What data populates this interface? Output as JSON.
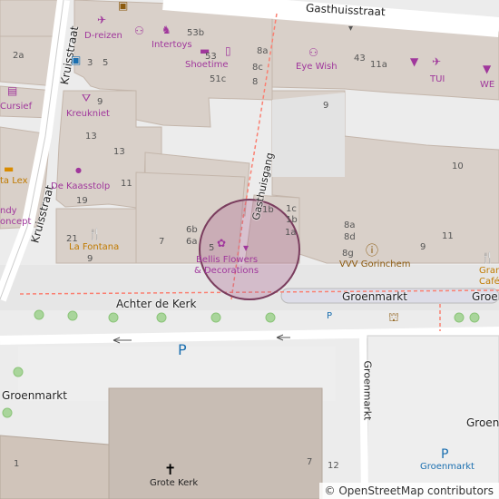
{
  "attribution": "© OpenStreetMap contributors",
  "colors": {
    "building": "#d9d0c9",
    "building_stroke": "#c4b6ab",
    "footway": "#fa8072",
    "poi": "#a0379c",
    "marker": "#a85c8c"
  },
  "streets": {
    "gasthuisstraat": "Gasthuisstraat",
    "kruisstraat_top": "Kruisstraat",
    "kruisstraat_bottom": "Kruisstraat",
    "gasthuisgang": "Gasthuisgang",
    "groenmarkt": "Groenmarkt",
    "groenmarkt_right": "Groen",
    "achter_de_kerk": "Achter de Kerk",
    "groenmarkt_left": "Groenmarkt",
    "groenmarkt_vertical": "Groenmarkt",
    "groenmarkt_far_right": "Groenm"
  },
  "pois": {
    "dreizen": "D-reizen",
    "intertoys": "Intertoys",
    "shoetime": "Shoetime",
    "eyewish": "Eye Wish",
    "tui": "TUI",
    "we": "WE",
    "cursief": "Cursief",
    "kreukniet": "Kreukniet",
    "kaasstolp": "De Kaasstolp",
    "fontana": "La Fontana",
    "bellis_line1": "Bellis Flowers",
    "bellis_line2": "& Decorations",
    "vvv": "VVV Gorinchem",
    "grand_line1": "Grand",
    "grand_line2": "Café TA",
    "lex": "ta Lex",
    "ndy": "ndy",
    "oncept": "oncept",
    "grote_kerk": "Grote Kerk",
    "parking_label": "Groenmarkt",
    "parking_small": "P",
    "parking_big": "P",
    "parking_right": "P"
  },
  "house_numbers": {
    "n2a": "2a",
    "n3": "3",
    "n5": "5",
    "n53b": "53b",
    "n53": "53",
    "n8a": "8a",
    "n8c": "8c",
    "n51c": "51c",
    "n8": "8",
    "n43": "43",
    "n11a": "11a",
    "n9a": "9",
    "n9b": "9",
    "n13a": "13",
    "n13b": "13",
    "n10": "10",
    "n11a2": "11",
    "n19": "19",
    "n21": "21",
    "n9c": "9",
    "n7": "7",
    "n6b": "6b",
    "n6a": "6a",
    "n5b": "5",
    "n1b": "1b",
    "n1c": "1c",
    "n1b2": "1b",
    "n1a": "1a",
    "n8a2": "8a",
    "n8d": "8d",
    "n8g": "8g",
    "n9d": "9",
    "n11b": "11",
    "n1": "1",
    "n7b": "7",
    "n12": "12"
  }
}
